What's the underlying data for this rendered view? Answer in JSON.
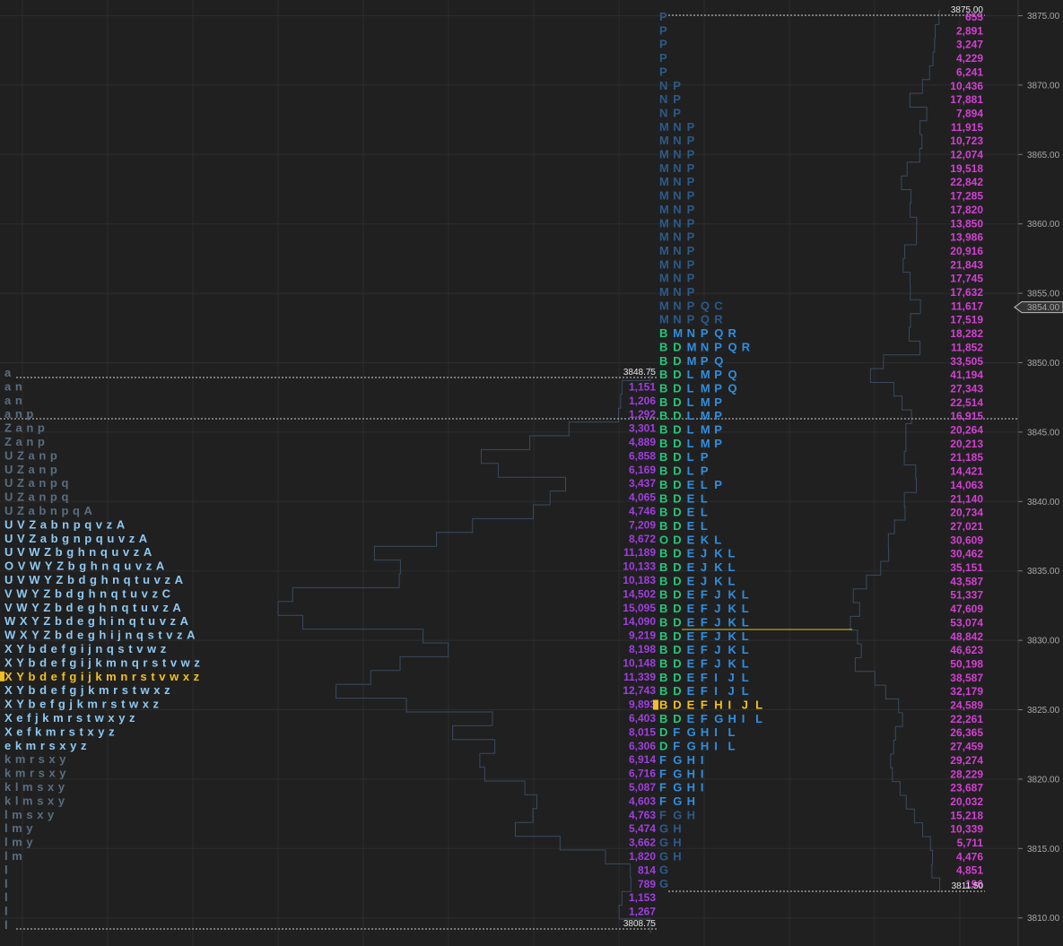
{
  "colors": {
    "background": "#202020",
    "grid": "#2c2c2c",
    "axis_text": "#a8a8a8",
    "tpo_dim": "#5a6e80",
    "tpo_light": "#8ec9f2",
    "tpo_blue": "#2f8fe0",
    "tpo_dim_blue": "#2c5a8a",
    "tpo_green": "#22c87a",
    "tpo_poc": "#f0c020",
    "volume_day1": "#a03ee0",
    "volume_day2": "#d43fd4",
    "profile_line": "#3a4a5e",
    "hline": "#cfcfcf",
    "poc_line": "#d8c020",
    "price_marker_bg": "#353535"
  },
  "chart_data": [
    {
      "type": "table",
      "profile": "left",
      "price_step": 1.25,
      "high_label": "3848.75",
      "low_label": "3808.75",
      "rows": [
        {
          "price": 3848.75,
          "tpo": "a",
          "volume": ""
        },
        {
          "price": 3847.5,
          "tpo": "an",
          "volume": "1,151"
        },
        {
          "price": 3846.25,
          "tpo": "an",
          "volume": "1,206"
        },
        {
          "price": 3845.0,
          "tpo": "anp",
          "volume": "1,292"
        },
        {
          "price": 3843.75,
          "tpo": "Zanp",
          "volume": "3,301"
        },
        {
          "price": 3842.5,
          "tpo": "Zanp",
          "volume": "4,889"
        },
        {
          "price": 3841.25,
          "tpo": "UZanp",
          "volume": "6,858"
        },
        {
          "price": 3840.0,
          "tpo": "UZanp",
          "volume": "6,169"
        },
        {
          "price": 3838.75,
          "tpo": "UZanpq",
          "volume": "3,437"
        },
        {
          "price": 3837.5,
          "tpo": "UZanpq",
          "volume": "4,065"
        },
        {
          "price": 3836.25,
          "tpo": "UZabnpqA",
          "volume": "4,746"
        },
        {
          "price": 3835.0,
          "tpo": "UVZabnpqvzA",
          "volume": "7,209"
        },
        {
          "price": 3833.75,
          "tpo": "UVZabgnpquvzA",
          "volume": "8,672"
        },
        {
          "price": 3832.5,
          "tpo": "UVWZbghnquvzA",
          "volume": "11,189"
        },
        {
          "price": 3831.25,
          "tpo": "OVWYZbghnquvzA",
          "volume": "10,133"
        },
        {
          "price": 3830.0,
          "tpo": "UVWYZbdghnqtuvzA",
          "volume": "10,183"
        },
        {
          "price": 3828.75,
          "tpo": "VWYZbdghnqtuvzC",
          "volume": "14,502"
        },
        {
          "price": 3827.5,
          "tpo": "VWYZbdeghnqtuvzA",
          "volume": "15,095"
        },
        {
          "price": 3826.25,
          "tpo": "WXYZbdeghinqtuvzA",
          "volume": "14,090"
        },
        {
          "price": 3825.0,
          "tpo": "WXYZbdeghijnqstvzA",
          "volume": "9,219"
        },
        {
          "price": 3823.75,
          "tpo": "XYbdefgijnqstvwz",
          "volume": "8,198"
        },
        {
          "price": 3822.5,
          "tpo": "XYbdefgijkmnqrstvwz",
          "volume": "10,148"
        },
        {
          "price": 3821.25,
          "tpo": "XYbdefgijkmnrstvwxz",
          "volume": "11,339"
        },
        {
          "price": 3820.0,
          "tpo": "XYbdefgjkmrstwxz",
          "volume": "12,743"
        },
        {
          "price": 3818.75,
          "tpo": "XYbefgjkmrstwxz",
          "volume": "9,893"
        },
        {
          "price": 3817.5,
          "tpo": "Xefjkmrstwxyz",
          "volume": "6,403"
        },
        {
          "price": 3816.25,
          "tpo": "Xefkmrstxyz",
          "volume": "8,015"
        },
        {
          "price": 3815.0,
          "tpo": "ekmrsxyz",
          "volume": "6,306"
        },
        {
          "price": 3813.75,
          "tpo": "kmrsxy",
          "volume": "6,914"
        },
        {
          "price": 3812.5,
          "tpo": "kmrsxy",
          "volume": "6,716"
        },
        {
          "price": 3811.25,
          "tpo": "klmsxy",
          "volume": "5,087"
        },
        {
          "price": 3810.0,
          "tpo": "klmsxy",
          "volume": "4,603"
        },
        {
          "price": 3808.75,
          "tpo": "lmsxy",
          "volume": "4,763"
        },
        {
          "price": 3807.5,
          "tpo": "lmy",
          "volume": "5,474"
        },
        {
          "price": 3806.25,
          "tpo": "lmy",
          "volume": "3,662"
        },
        {
          "price": 3805.0,
          "tpo": "lm",
          "volume": "1,820"
        },
        {
          "price": 3803.75,
          "tpo": "l",
          "volume": "814"
        },
        {
          "price": 3802.5,
          "tpo": "l",
          "volume": "789"
        },
        {
          "price": 3801.25,
          "tpo": "l",
          "volume": "1,153"
        },
        {
          "price": 3800.0,
          "tpo": "l",
          "volume": "1,267"
        },
        {
          "price": 3798.75,
          "tpo": "l",
          "volume": ""
        }
      ]
    },
    {
      "type": "table",
      "profile": "right",
      "high_label": "3875.00",
      "low_label": "3811.50",
      "rows": [
        {
          "tpo": "P",
          "volume": "655"
        },
        {
          "tpo": "P",
          "volume": "2,891"
        },
        {
          "tpo": "P",
          "volume": "3,247"
        },
        {
          "tpo": "P",
          "volume": "4,229"
        },
        {
          "tpo": "P",
          "volume": "6,241"
        },
        {
          "tpo": "NP",
          "volume": "10,436"
        },
        {
          "tpo": "NP",
          "volume": "17,881"
        },
        {
          "tpo": "NP",
          "volume": "7,894"
        },
        {
          "tpo": "MNP",
          "volume": "11,915"
        },
        {
          "tpo": "MNP",
          "volume": "10,723"
        },
        {
          "tpo": "MNP",
          "volume": "12,074"
        },
        {
          "tpo": "MNP",
          "volume": "19,518"
        },
        {
          "tpo": "MNP",
          "volume": "22,842"
        },
        {
          "tpo": "MNP",
          "volume": "17,285"
        },
        {
          "tpo": "MNP",
          "volume": "17,820"
        },
        {
          "tpo": "MNP",
          "volume": "13,850"
        },
        {
          "tpo": "MNP",
          "volume": "13,986"
        },
        {
          "tpo": "MNP",
          "volume": "20,916"
        },
        {
          "tpo": "MNP",
          "volume": "21,843"
        },
        {
          "tpo": "MNP",
          "volume": "17,745"
        },
        {
          "tpo": "MNP",
          "volume": "17,632"
        },
        {
          "tpo": "MNPQC",
          "volume": "11,617"
        },
        {
          "tpo": "MNPQR",
          "volume": "17,519"
        },
        {
          "tpo": "BMNPQR",
          "volume": "18,282"
        },
        {
          "tpo": "BDMNPQR",
          "volume": "11,852"
        },
        {
          "tpo": "BDMPQ",
          "volume": "33,505"
        },
        {
          "tpo": "BDLMPQ",
          "volume": "41,194"
        },
        {
          "tpo": "BDLMPQ",
          "volume": "27,343"
        },
        {
          "tpo": "BDLMP",
          "volume": "22,514"
        },
        {
          "tpo": "BDLMP",
          "volume": "16,915"
        },
        {
          "tpo": "BDLMP",
          "volume": "20,264"
        },
        {
          "tpo": "BDLMP",
          "volume": "20,213"
        },
        {
          "tpo": "BDLP",
          "volume": "21,185"
        },
        {
          "tpo": "BDLP",
          "volume": "14,421"
        },
        {
          "tpo": "BDELP",
          "volume": "14,063"
        },
        {
          "tpo": "BDEL",
          "volume": "21,140"
        },
        {
          "tpo": "BDEL",
          "volume": "20,734"
        },
        {
          "tpo": "BDEL",
          "volume": "27,021"
        },
        {
          "tpo": "ODEKL",
          "volume": "30,609"
        },
        {
          "tpo": "BDEJKL",
          "volume": "30,462"
        },
        {
          "tpo": "BDEJKL",
          "volume": "35,151"
        },
        {
          "tpo": "BDEJKL",
          "volume": "43,587"
        },
        {
          "tpo": "BDEFJKL",
          "volume": "51,337"
        },
        {
          "tpo": "BDEFJKL",
          "volume": "47,609"
        },
        {
          "tpo": "BDEFJKL",
          "volume": "53,074"
        },
        {
          "tpo": "BDEFJKL",
          "volume": "48,842"
        },
        {
          "tpo": "BDEFJKL",
          "volume": "46,623"
        },
        {
          "tpo": "BDEFJKL",
          "volume": "50,198"
        },
        {
          "tpo": "BDEFIJL",
          "volume": "38,587"
        },
        {
          "tpo": "BDEFIJL",
          "volume": "32,179"
        },
        {
          "tpo": "BDEFHIJL",
          "volume": "24,589"
        },
        {
          "tpo": "BDEFGHIL",
          "volume": "22,261"
        },
        {
          "tpo": "DFGHIL",
          "volume": "26,365"
        },
        {
          "tpo": "DFGHIL",
          "volume": "27,459"
        },
        {
          "tpo": "FGHI",
          "volume": "29,274"
        },
        {
          "tpo": "FGHI",
          "volume": "28,229"
        },
        {
          "tpo": "FGHI",
          "volume": "23,687"
        },
        {
          "tpo": "FGH",
          "volume": "20,032"
        },
        {
          "tpo": "FGH",
          "volume": "15,218"
        },
        {
          "tpo": "GH",
          "volume": "10,339"
        },
        {
          "tpo": "GH",
          "volume": "5,711"
        },
        {
          "tpo": "GH",
          "volume": "4,476"
        },
        {
          "tpo": "G",
          "volume": "4,851"
        },
        {
          "tpo": "G",
          "volume": "196"
        }
      ]
    }
  ],
  "axis": {
    "ticks": [
      "3875.00",
      "3870.00",
      "3865.00",
      "3860.00",
      "3855.00",
      "3850.00",
      "3845.00",
      "3840.00",
      "3835.00",
      "3830.00",
      "3825.00",
      "3820.00",
      "3815.00",
      "3810.00"
    ],
    "current_price": "3854.00"
  }
}
